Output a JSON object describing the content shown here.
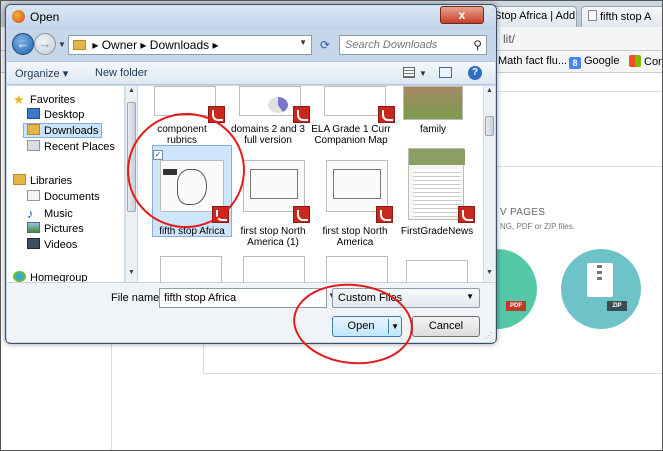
{
  "browser": {
    "tabs": [
      {
        "label": "Stop Africa | Add Pa"
      },
      {
        "label": "fifth stop A"
      }
    ],
    "url_fragment": "lit/",
    "bookmarks": [
      {
        "label": "Math fact flu..."
      },
      {
        "label": "Google"
      },
      {
        "label": "Conne"
      }
    ],
    "upload_title": "V PAGES",
    "upload_sub": "NG, PDF or ZIP files.",
    "pdf_tag": "PDF",
    "zip_tag": "ZIP",
    "colors": {
      "teal": "#6ec3c8",
      "green": "#55c8a8"
    }
  },
  "dialog": {
    "title": "Open",
    "close_glyph": "x",
    "address": {
      "sep1": "▸",
      "crumb1": "Owner",
      "sep2": "▸",
      "crumb2": "Downloads",
      "sep3": "▸"
    },
    "search_placeholder": "Search Downloads",
    "toolbar": {
      "organize": "Organize ▾",
      "new_folder": "New folder"
    },
    "nav": {
      "favorites": "Favorites",
      "desktop": "Desktop",
      "downloads": "Downloads",
      "recent": "Recent Places",
      "libraries": "Libraries",
      "documents": "Documents",
      "music": "Music",
      "pictures": "Pictures",
      "videos": "Videos",
      "homegroup": "Homegroup"
    },
    "files": [
      {
        "label": "component rubrics"
      },
      {
        "label": "domains 2 and 3 full version"
      },
      {
        "label": "ELA Grade 1 Curr Companion Map"
      },
      {
        "label": "family"
      },
      {
        "label": "fifth stop Africa"
      },
      {
        "label": "first stop North America (1)"
      },
      {
        "label": "first stop North America"
      },
      {
        "label": "FirstGradeNews"
      }
    ],
    "filename_label": "File name:",
    "filename_value": "fifth stop Africa",
    "filetype": "Custom Files",
    "open_label": "Open",
    "cancel_label": "Cancel"
  }
}
